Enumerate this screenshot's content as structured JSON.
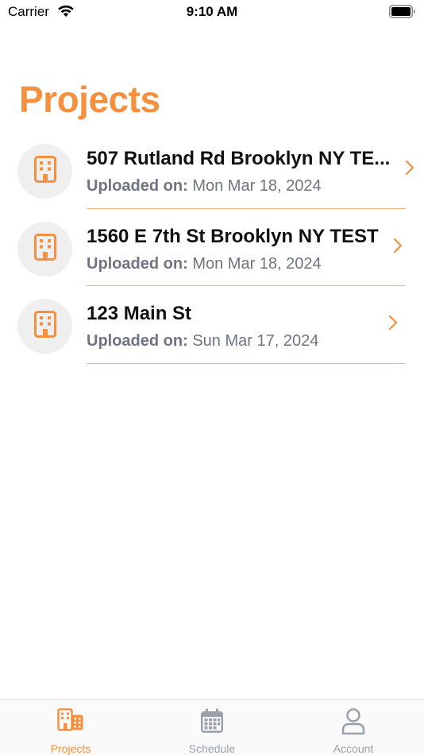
{
  "status_bar": {
    "carrier": "Carrier",
    "time": "9:10 AM"
  },
  "page": {
    "title": "Projects"
  },
  "projects": [
    {
      "title": "507 Rutland Rd Brooklyn NY TE...",
      "uploaded_label": "Uploaded on:",
      "uploaded_date": "Mon Mar 18, 2024",
      "icon": "building-icon"
    },
    {
      "title": "1560 E 7th St Brooklyn NY TEST",
      "uploaded_label": "Uploaded on:",
      "uploaded_date": "Mon Mar 18, 2024",
      "icon": "building-icon"
    },
    {
      "title": "123 Main St",
      "uploaded_label": "Uploaded on:",
      "uploaded_date": "Sun Mar 17, 2024",
      "icon": "building-icon"
    }
  ],
  "tab_bar": {
    "tabs": [
      {
        "label": "Projects",
        "icon": "buildings-icon",
        "active": true
      },
      {
        "label": "Schedule",
        "icon": "calendar-icon",
        "active": false
      },
      {
        "label": "Account",
        "icon": "person-icon",
        "active": false
      }
    ]
  },
  "colors": {
    "accent": "#F5913E",
    "divider": "#F5B27A",
    "muted_text": "#6E7480",
    "inactive_tab": "#9AA1AD",
    "avatar_bg": "#EFEFEF"
  }
}
